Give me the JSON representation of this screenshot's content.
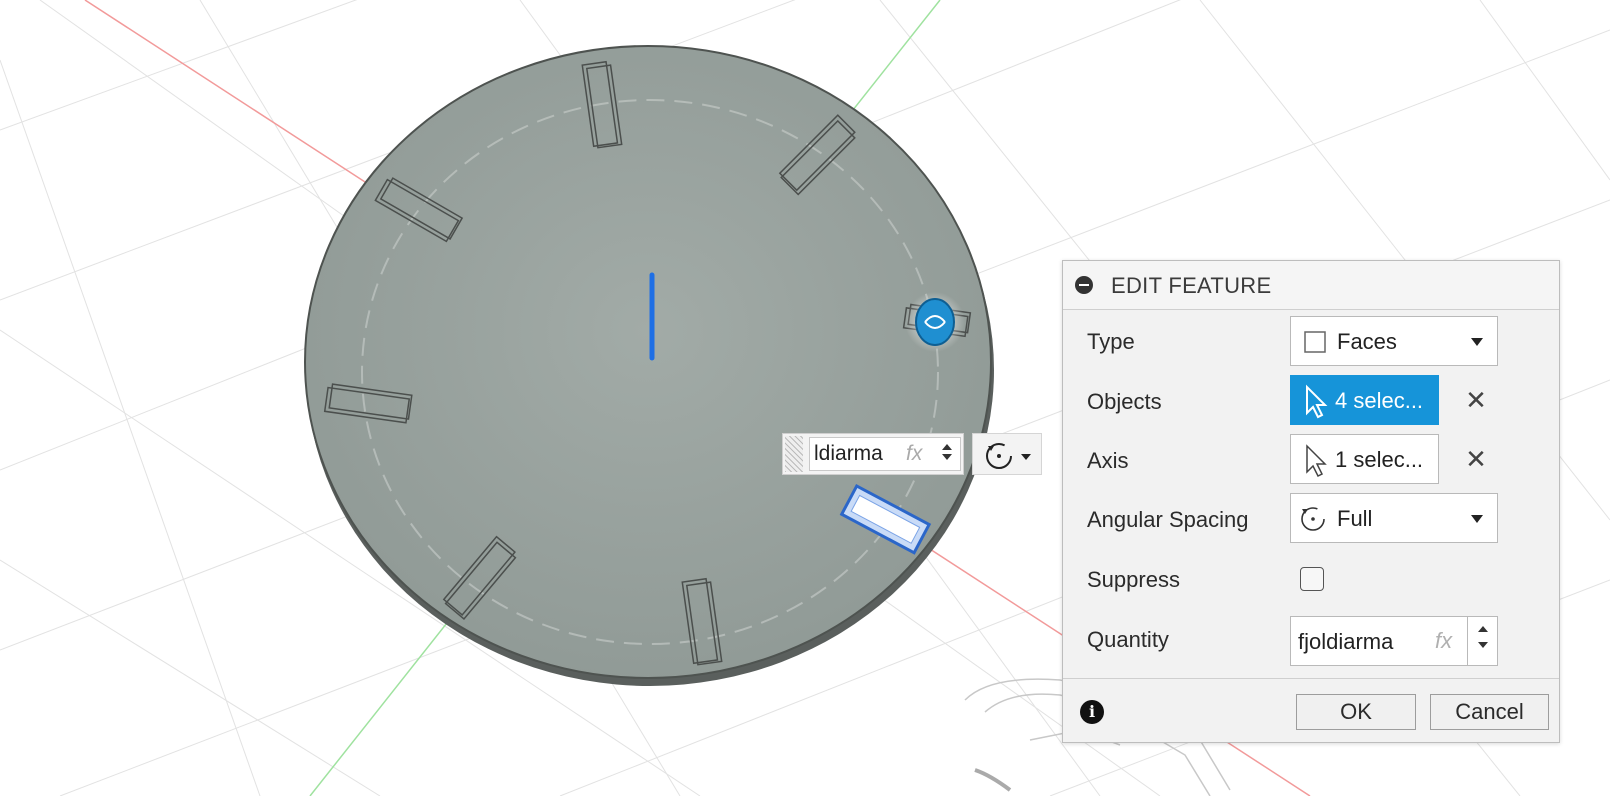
{
  "canvas_label": "ldiarma",
  "canvas_fx": "fx",
  "dialog": {
    "title": "EDIT FEATURE",
    "rows": {
      "type": {
        "label": "Type",
        "value": "Faces",
        "icon": "square-outline-icon"
      },
      "objects": {
        "label": "Objects",
        "value": "4 selec...",
        "icon": "cursor-arrow-icon"
      },
      "axis": {
        "label": "Axis",
        "value": "1 selec...",
        "icon": "cursor-arrow-icon"
      },
      "angular_spacing": {
        "label": "Angular Spacing",
        "value": "Full",
        "icon": "rotate-icon"
      },
      "suppress": {
        "label": "Suppress",
        "checked": false
      },
      "quantity": {
        "label": "Quantity",
        "value": "fjoldiarma",
        "fx": "fx"
      }
    },
    "ok_label": "OK",
    "cancel_label": "Cancel"
  },
  "colors": {
    "accent": "#1694d9",
    "disk": "#98a19d",
    "axis_red": "#f29a9a",
    "axis_green": "#9fe29f"
  }
}
